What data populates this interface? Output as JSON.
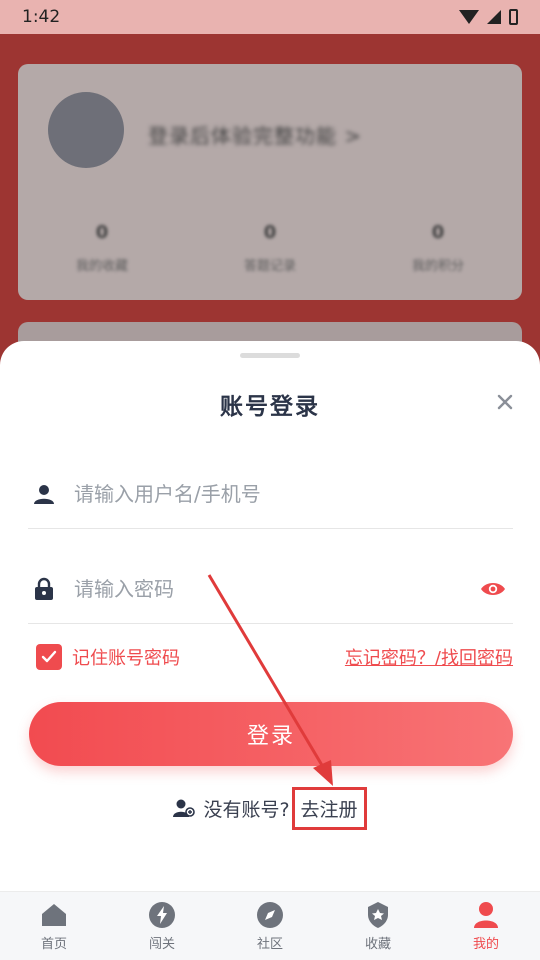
{
  "status_bar": {
    "time": "1:42"
  },
  "background": {
    "login_prompt": "登录后体验完整功能 >",
    "stats": [
      {
        "value": "0",
        "label": "我的收藏"
      },
      {
        "value": "0",
        "label": "答题记录"
      },
      {
        "value": "0",
        "label": "我的积分"
      }
    ]
  },
  "login_sheet": {
    "title": "账号登录",
    "username_placeholder": "请输入用户名/手机号",
    "password_placeholder": "请输入密码",
    "remember_label": "记住账号密码",
    "remember_checked": true,
    "forgot_label": "忘记密码？/找回密码",
    "login_button": "登录",
    "no_account_text": "没有账号?",
    "register_link": "去注册"
  },
  "bottom_nav": {
    "items": [
      {
        "label": "首页",
        "icon": "home-icon"
      },
      {
        "label": "闯关",
        "icon": "lightning-icon"
      },
      {
        "label": "社区",
        "icon": "compass-icon"
      },
      {
        "label": "收藏",
        "icon": "badge-icon"
      },
      {
        "label": "我的",
        "icon": "user-icon",
        "active": true
      }
    ]
  },
  "colors": {
    "accent": "#ef4b4e",
    "text_dark": "#2b3448",
    "annotation": "#e03b3b"
  }
}
